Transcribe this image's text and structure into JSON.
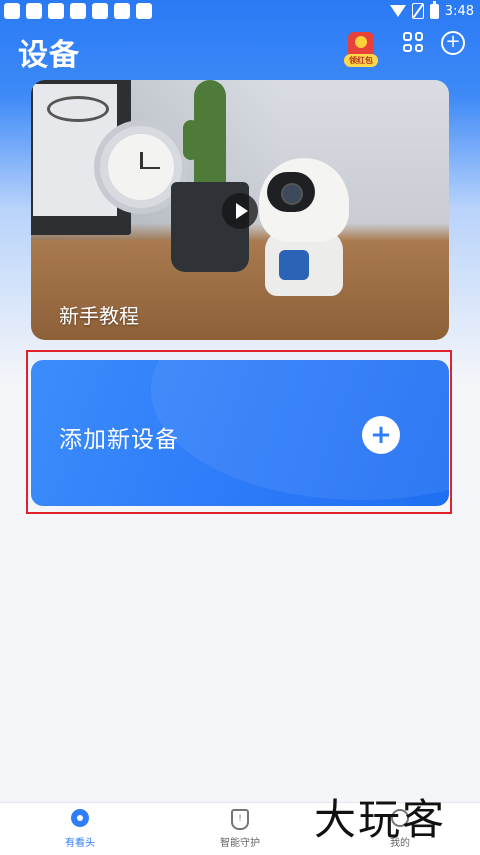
{
  "status_bar": {
    "time": "3:48"
  },
  "header": {
    "title": "设备",
    "red_packet_label": "领红包"
  },
  "tutorial": {
    "label": "新手教程"
  },
  "add_device": {
    "label": "添加新设备",
    "plus": "+"
  },
  "bottom_nav": {
    "items": [
      {
        "label": "有看头",
        "icon": "home-camera-icon",
        "active": true
      },
      {
        "label": "智能守护",
        "icon": "shield-icon",
        "active": false
      },
      {
        "label": "我的",
        "icon": "person-icon",
        "active": false
      }
    ]
  },
  "watermark": {
    "text": "大玩客"
  },
  "colors": {
    "accent": "#2f7df9",
    "highlight": "#e0202a"
  }
}
